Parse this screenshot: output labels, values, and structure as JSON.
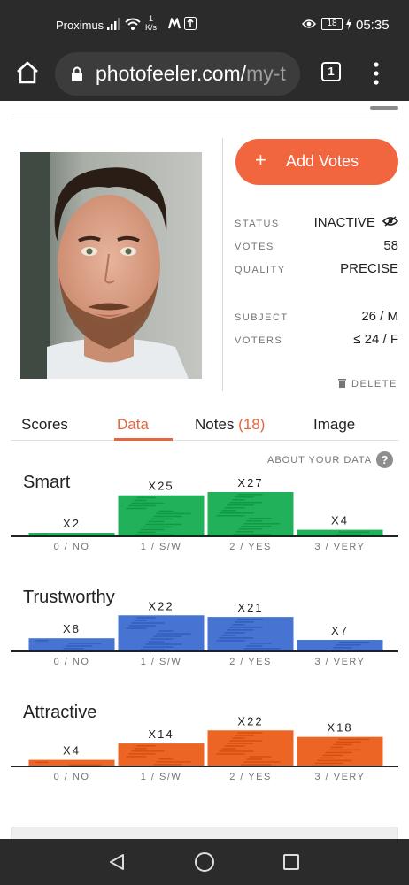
{
  "status_bar": {
    "carrier": "Proximus",
    "speed_value": "1",
    "speed_unit": "K/s",
    "battery": "18",
    "time": "05:35"
  },
  "browser": {
    "url_visible": "photofeeler.com/",
    "url_faded": "my-t",
    "tab_count": "1"
  },
  "photo": {
    "icon": "profile-photo"
  },
  "actions": {
    "add_votes_icon": "+",
    "add_votes_label": "Add Votes",
    "delete_label": "DELETE"
  },
  "info": {
    "status_label": "STATUS",
    "status_value": "INACTIVE",
    "votes_label": "VOTES",
    "votes_value": "58",
    "quality_label": "QUALITY",
    "quality_value": "PRECISE",
    "subject_label": "SUBJECT",
    "subject_value": "26 / M",
    "voters_label": "VOTERS",
    "voters_value": "≤ 24 / F"
  },
  "tabs": {
    "scores": "Scores",
    "data": "Data",
    "notes": "Notes",
    "notes_count": "(18)",
    "image": "Image"
  },
  "about_data": "ABOUT YOUR DATA",
  "help_icon": "?",
  "charts": [
    {
      "title": "Smart",
      "color": "#20b15a",
      "labels": [
        "0 / NO",
        "1 / S/W",
        "2 / YES",
        "3 / VERY"
      ],
      "counts": [
        "X2",
        "X25",
        "X27",
        "X4"
      ]
    },
    {
      "title": "Trustworthy",
      "color": "#4774d3",
      "labels": [
        "0 / NO",
        "1 / S/W",
        "2 / YES",
        "3 / VERY"
      ],
      "counts": [
        "X8",
        "X22",
        "X21",
        "X7"
      ]
    },
    {
      "title": "Attractive",
      "color": "#ed6524",
      "labels": [
        "0 / NO",
        "1 / S/W",
        "2 / YES",
        "3 / VERY"
      ],
      "counts": [
        "X4",
        "X14",
        "X22",
        "X18"
      ]
    }
  ],
  "chart_data": [
    {
      "type": "bar",
      "title": "Smart",
      "categories": [
        "0 / NO",
        "1 / S/W",
        "2 / YES",
        "3 / VERY"
      ],
      "values": [
        2,
        25,
        27,
        4
      ]
    },
    {
      "type": "bar",
      "title": "Trustworthy",
      "categories": [
        "0 / NO",
        "1 / S/W",
        "2 / YES",
        "3 / VERY"
      ],
      "values": [
        8,
        22,
        21,
        7
      ]
    },
    {
      "type": "bar",
      "title": "Attractive",
      "categories": [
        "0 / NO",
        "1 / S/W",
        "2 / YES",
        "3 / VERY"
      ],
      "values": [
        4,
        14,
        22,
        18
      ]
    }
  ]
}
